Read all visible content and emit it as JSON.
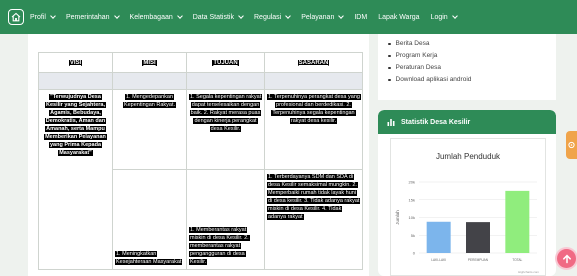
{
  "nav": {
    "items": [
      {
        "label": "Profil",
        "dropdown": true
      },
      {
        "label": "Pemerintahan",
        "dropdown": true
      },
      {
        "label": "Kelembagaan",
        "dropdown": true
      },
      {
        "label": "Data Statistik",
        "dropdown": true
      },
      {
        "label": "Regulasi",
        "dropdown": true
      },
      {
        "label": "Pelayanan",
        "dropdown": true
      },
      {
        "label": "IDM",
        "dropdown": false
      },
      {
        "label": "Lapak Warga",
        "dropdown": false
      },
      {
        "label": "Login",
        "dropdown": true
      }
    ],
    "home_icon": "home-icon"
  },
  "table": {
    "headers": {
      "visi": "VISI",
      "misi": "MISI",
      "tujuan": "TUJUAN",
      "sasaran": "SASARAN"
    },
    "visi_text": "\"Terwujudnya Desa Kesilir yang Sejahtera, Agamis, Bebudaya, Demokratis, Aman dan Amanah, serta Mampu Memberikan Pelayanan yang Prima Kepada Masyarakat\"",
    "misi_1": "1. Mengedepankan Kepentingan Rakyat.",
    "misi_2": "1. Meningkatkan Kesejahteraan Masyarakat",
    "tujuan_1": "1. Segala kepentingan rakyat dapat terselesaikan dengan baik. 2. Rakyat merasa puas dengan kinerja perangkat desa Kesilir.",
    "tujuan_2": "1. Memberantas rakyat miskin di desa Kesilir. 2. memberantas rakyat pengangguran di desa Kesilir.",
    "sasaran_1": "1. Terpenuhinya perangkat desa yang profesional dan berdedikasi. 2. Terpenuhinya segala kepentingan rakyat desa kesilir.",
    "sasaran_2": "1. Terberdayanya SDM dan SDA di desa Kesilir semaksimal mungkin. 2. Memperbaiki rumah tidak layak huni di desa kesilir. 3. Tidak adanya rakyat miskin di desa Kesilir. 4. Tidak adanya rakyat"
  },
  "sidebar": {
    "links": [
      "Berita Desa",
      "Program Kerja",
      "Peraturan Desa",
      "Download aplikasi android"
    ]
  },
  "stat_widget": {
    "title": "Statistik Desa Kesilir",
    "icon": "bar-chart-icon"
  },
  "chart_data": {
    "type": "bar",
    "title": "Jumlah Penduduk",
    "ylabel": "Jumlah",
    "categories": [
      "LAKI-LAKI",
      "PEREMPUAN",
      "TOTAL"
    ],
    "values": [
      8800,
      8700,
      17500
    ],
    "colors": [
      "#7cb5ec",
      "#434348",
      "#90ed7d"
    ],
    "yticks": [
      "0",
      "5k",
      "10k",
      "15k",
      "20k"
    ],
    "ylim": [
      0,
      20000
    ],
    "grid": true,
    "credit": "Highcharts.com"
  },
  "colors": {
    "brand": "#2e8b57",
    "accent_orange": "#f0a44a",
    "scroll_button": "#f06a84"
  }
}
